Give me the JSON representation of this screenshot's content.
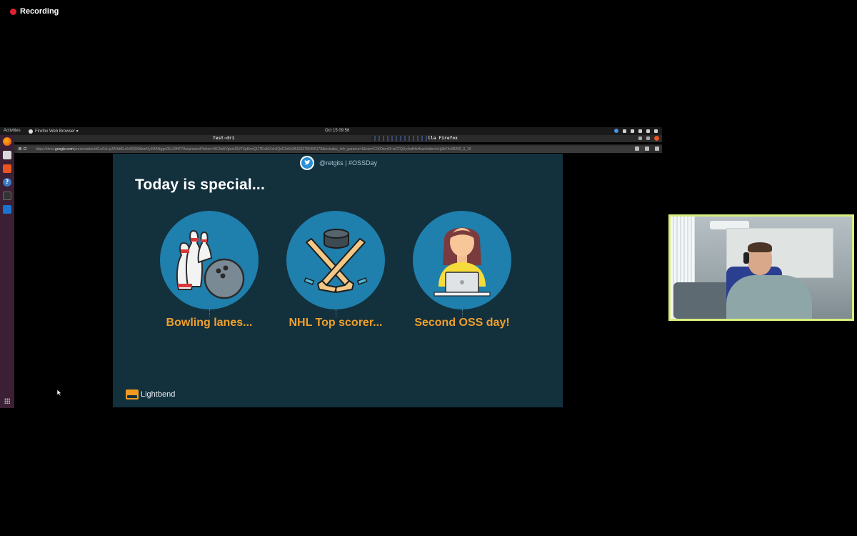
{
  "recording": {
    "label": "Recording",
    "color": "#e0212d"
  },
  "topbar": {
    "activities": "Activities",
    "app_name": "Firefox Web Browser ▾",
    "clock": "Oct 15  09:56"
  },
  "browser": {
    "title": "Test-dri                                                                     zilla Firefox",
    "url_prefix": "https://docs.",
    "url_domain": "google.com",
    "url_rest": "/presentation/d/1eGxl.qUW3dtEuXrSR9Xi8zmOyJMANgge0EcJ9HF7Aw/present?token=AC4w5VgbzlJ3UTXp8vmQUTEwKiXxhJQeF2w%3A1602766466178&includes_info_params=1&eisi=CJKOsrrrDl-wCFQUy4odHsHxw#slide=id.g9b74c98266_0_15"
  },
  "slide": {
    "twitter_handle": "@retgits | #OSSDay",
    "heading": "Today is special...",
    "items": [
      {
        "label": "Bowling lanes...",
        "icon": "bowling-icon"
      },
      {
        "label": "NHL Top scorer...",
        "icon": "hockey-icon"
      },
      {
        "label": "Second OSS day!",
        "icon": "developer-icon"
      }
    ],
    "brand": "Lightbend",
    "colors": {
      "background": "#13303d",
      "circle": "#1f7fad",
      "label": "#f0a02b",
      "heading": "#ffffff"
    }
  }
}
